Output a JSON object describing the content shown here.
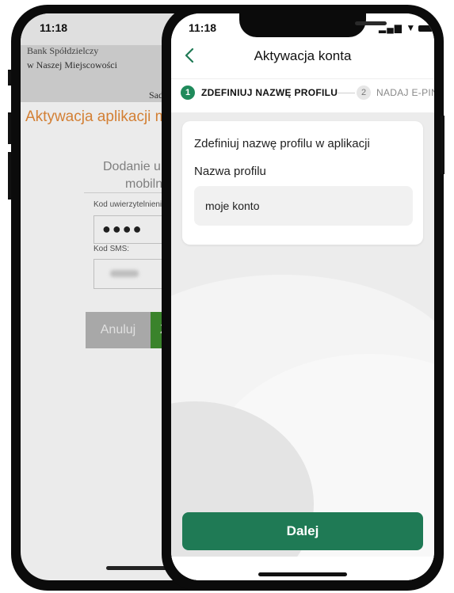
{
  "back_phone": {
    "time": "11:18",
    "bank_line1": "Bank Spółdzielczy",
    "bank_line2": "w Naszej Miejscowości",
    "header_tail": "Sad",
    "title": "Aktywacja aplikacji mo",
    "add_device_line1": "Dodanie urz",
    "add_device_line2": "mobilne",
    "auth_code_label": "Kod uwierzytelnienia",
    "auth_code_value": "●●●●",
    "sms_code_label": "Kod SMS:",
    "cancel_label": "Anuluj",
    "confirm_label": "Z"
  },
  "front_phone": {
    "time": "11:18",
    "signal_glyph": "▂▄▆",
    "wifi_glyph": "▼",
    "title": "Aktywacja konta",
    "steps": [
      {
        "number": "1",
        "label": "ZDEFINIUJ NAZWĘ PROFILU"
      },
      {
        "number": "2",
        "label": "NADAJ E-PIN"
      }
    ],
    "card_heading": "Zdefiniuj nazwę profilu w aplikacji",
    "field_label": "Nazwa profilu",
    "field_value": "moje konto",
    "next_label": "Dalej"
  },
  "colors": {
    "accent_green": "#1f7a55",
    "step_active": "#1f8a5b",
    "back_title_orange": "#e58b3a",
    "back_confirm_green": "#3f8f2f"
  },
  "icons": [
    "back-chevron-icon",
    "signal-icon",
    "wifi-icon",
    "battery-icon"
  ]
}
